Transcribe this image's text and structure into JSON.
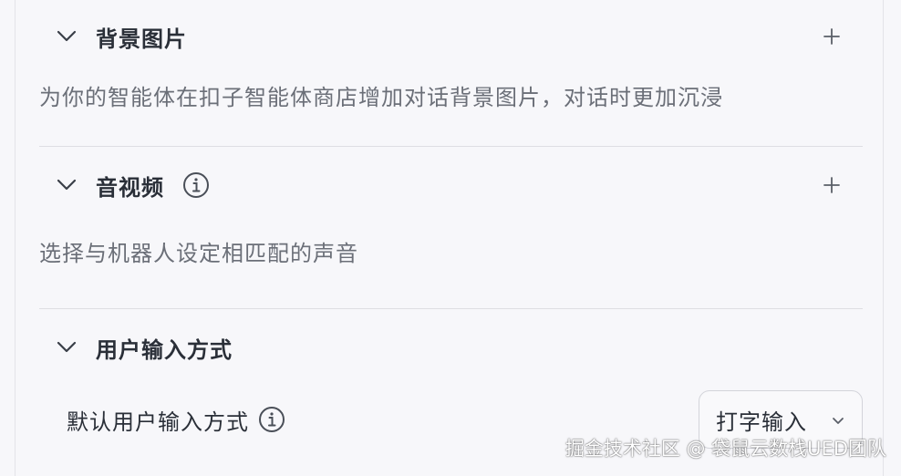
{
  "sections": {
    "background": {
      "title": "背景图片",
      "description": "为你的智能体在扣子智能体商店增加对话背景图片，对话时更加沉浸",
      "add_icon": "plus-icon",
      "collapse_icon": "chevron-down-icon"
    },
    "audio_video": {
      "title": "音视频",
      "description": "选择与机器人设定相匹配的声音",
      "info_icon": "info-icon",
      "add_icon": "plus-icon",
      "collapse_icon": "chevron-down-icon"
    },
    "user_input": {
      "title": "用户输入方式",
      "collapse_icon": "chevron-down-icon",
      "default_method": {
        "label": "默认用户输入方式",
        "info_icon": "info-icon",
        "selected_value": "打字输入"
      }
    }
  },
  "watermark": "掘金技术社区 @ 袋鼠云数栈UED团队",
  "colors": {
    "background": "#f7f7fa",
    "text_primary": "#2a2f38",
    "text_secondary": "#6b6f78",
    "divider": "#dedee3",
    "border": "#d3d4da"
  }
}
